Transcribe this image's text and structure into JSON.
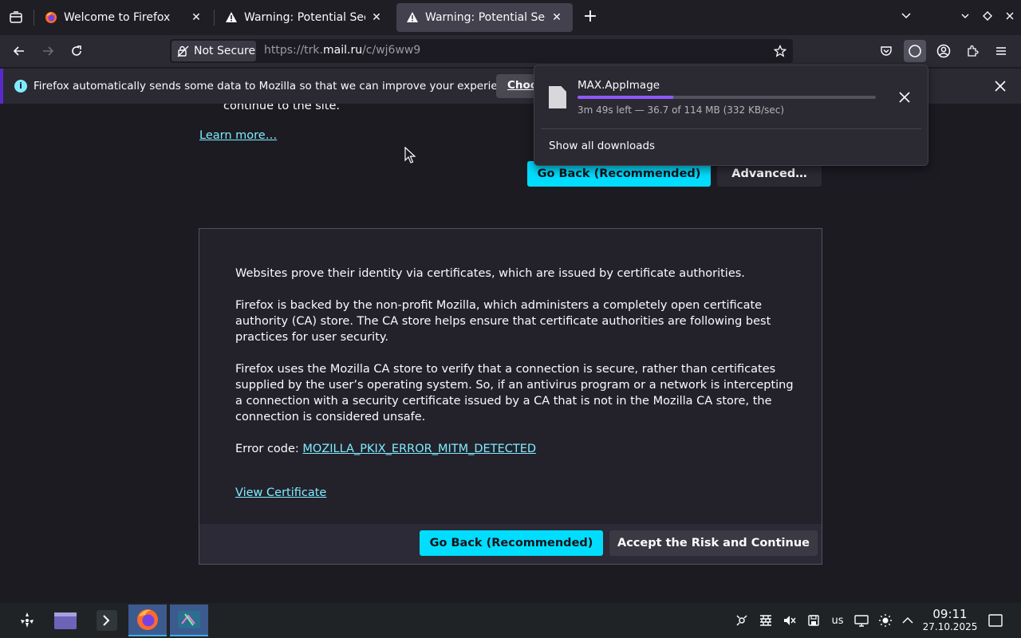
{
  "tabs": [
    {
      "title": "Welcome to Firefox",
      "close": "✕"
    },
    {
      "title": "Warning: Potential Security Risk Ahead",
      "close": "✕"
    },
    {
      "title": "Warning: Potential Security Risk Ahead",
      "close": "✕"
    }
  ],
  "newtab_label": "+",
  "urlbar": {
    "security_label": "Not Secure",
    "url_prefix": "https://trk.",
    "url_domain": "mail.ru",
    "url_path": "/c/wj6ww9"
  },
  "notification": {
    "message": "Firefox automatically sends some data to Mozilla so that we can improve your experience.",
    "button": "Choose What I Share"
  },
  "page": {
    "continue_text": "continue to the site.",
    "learn_more": "Learn more…",
    "go_back": "Go Back (Recommended)",
    "advanced": "Advanced…",
    "paragraph1": "Websites prove their identity via certificates, which are issued by certificate authorities.",
    "paragraph2": "Firefox is backed by the non-profit Mozilla, which administers a completely open certificate authority (CA) store. The CA store helps ensure that certificate authorities are following best practices for user security.",
    "paragraph3": "Firefox uses the Mozilla CA store to verify that a connection is secure, rather than certificates supplied by the user’s operating system. So, if an antivirus program or a network is intercepting a connection with a security certificate issued by a CA that is not in the Mozilla CA store, the connection is considered unsafe.",
    "error_label": "Error code: ",
    "error_code": "MOZILLA_PKIX_ERROR_MITM_DETECTED",
    "view_certificate": "View Certificate",
    "go_back_bottom": "Go Back (Recommended)",
    "accept_risk": "Accept the Risk and Continue"
  },
  "downloads": {
    "filename": "MAX.AppImage",
    "progress": 0.32,
    "status": "3m 49s left — 36.7 of 114 MB (332 KB/sec)",
    "show_all": "Show all downloads"
  },
  "taskbar": {
    "keyboard_layout": "us",
    "time": "09:11",
    "date": "27.10.2025"
  },
  "colors": {
    "accent": "#00ddff",
    "link": "#80ebff",
    "progress": "#9059ff",
    "notification_border": "#592acb"
  }
}
